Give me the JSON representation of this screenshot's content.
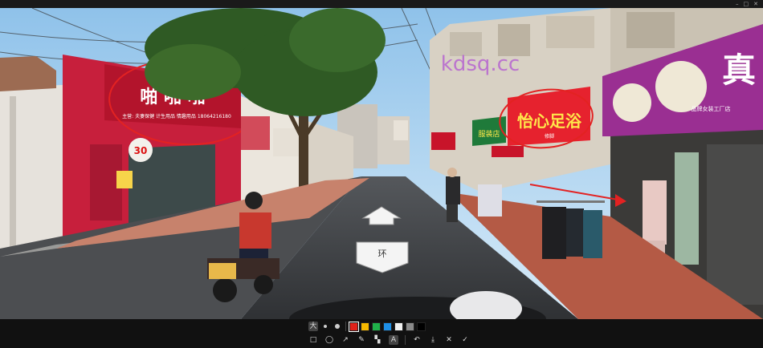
{
  "window": {
    "controls": [
      "–",
      "□",
      "✕"
    ]
  },
  "scene": {
    "watermark": "kdsq.cc",
    "left_shop": {
      "sign_big": "啪 啪 啪",
      "sign_small": "主营: 夫妻保健  计生用品  情趣用品  18064216180",
      "logo": "30"
    },
    "right_shop": {
      "sign": "怡心足浴",
      "sign_small": "修脚"
    },
    "far_right_shop": {
      "sign": "真",
      "sub": "品牌女装工厂店"
    },
    "green_sign": "服装店",
    "road_arrow_back_label": "环"
  },
  "toolbar": {
    "row1": {
      "text_size_label": "大",
      "colors": [
        "#e0221b",
        "#f5b800",
        "#20b24a",
        "#1e8fe6",
        "#f0f0f0",
        "#8a8a8a",
        "#000000"
      ],
      "selected_color": 0
    },
    "row2": {
      "rect": "□",
      "ellipse": "◯",
      "arrow": "↗",
      "pen": "✎",
      "mosaic": "▚",
      "text": "A",
      "undo": "↶",
      "download": "⤓",
      "cancel": "✕",
      "confirm": "✓"
    }
  }
}
